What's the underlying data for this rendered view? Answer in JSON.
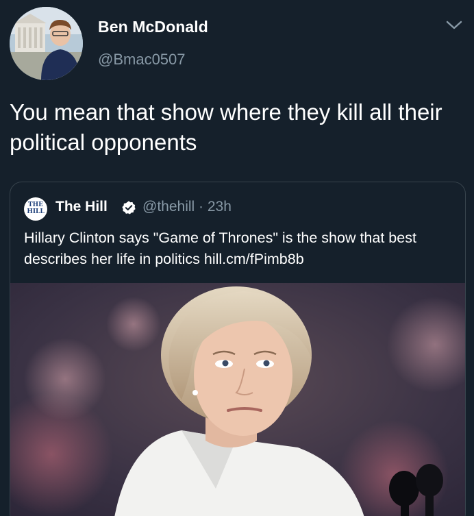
{
  "tweet": {
    "author": {
      "name": "Ben McDonald",
      "handle": "@Bmac0507"
    },
    "text": "You mean that show where they kill all their political opponents",
    "menu_icon": "chevron-down-icon"
  },
  "quoted_tweet": {
    "logo_text": "THE\nHILL",
    "author": {
      "name": "The Hill",
      "verified": true,
      "handle_time": "@thehill · 23h"
    },
    "text": "Hillary Clinton says \"Game of Thrones\" is the show that best describes her life in politics hill.cm/fPimb8b"
  },
  "colors": {
    "background": "#15202b",
    "secondary_text": "#8899a6",
    "border": "#38444d",
    "verified_badge": "#ffffff"
  }
}
